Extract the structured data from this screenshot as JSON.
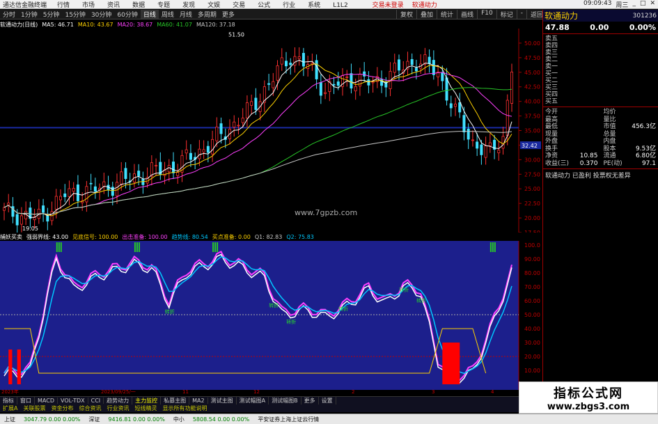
{
  "titlebar": {
    "app_title": "通达信金融终端",
    "menu": [
      "行情",
      "市场",
      "资讯",
      "数据",
      "专题",
      "发现",
      "文娱",
      "交易",
      "公式",
      "行业",
      "系统",
      "L1L2"
    ],
    "alerts": [
      "交易未登录",
      "软通动力"
    ],
    "time": "09:09:43",
    "weekday": "周三"
  },
  "toolbar": {
    "periods": [
      "分时",
      "1分钟",
      "5分钟",
      "15分钟",
      "30分钟",
      "60分钟",
      "日线",
      "周线",
      "月线",
      "多周期",
      "更多"
    ],
    "active": "日线",
    "right": [
      "复权",
      "叠加",
      "统计",
      "画线",
      "F10",
      "标记",
      "-",
      "返回"
    ]
  },
  "main": {
    "stock": "软通动力(日线)",
    "ma": [
      {
        "name": "MA5",
        "value": "46.71",
        "color": "#ffffff"
      },
      {
        "name": "MA10",
        "value": "43.67",
        "color": "#ffd200"
      },
      {
        "name": "MA20",
        "value": "38.67",
        "color": "#ff40ff"
      },
      {
        "name": "MA60",
        "value": "41.07",
        "color": "#28c828"
      },
      {
        "name": "MA120",
        "value": "37.18",
        "color": "#c8c8c8"
      }
    ],
    "high_label": "51.50",
    "low_label": "19.05",
    "price_tag": "32.42",
    "axis": [
      "50.00",
      "47.50",
      "45.00",
      "42.50",
      "40.00",
      "37.50",
      "35.00",
      "32.50",
      "30.00",
      "27.50",
      "25.00",
      "22.50",
      "20.00",
      "17.50"
    ],
    "site": "www.7gpzb.com"
  },
  "sub": {
    "title": "捕妖买卖",
    "params": [
      {
        "label": "强弱界线",
        "value": "43.00",
        "color": "#ffffff"
      },
      {
        "label": "见底信号",
        "value": "100.00",
        "color": "#ffd200"
      },
      {
        "label": "出击准备",
        "value": "100.00",
        "color": "#ff40ff"
      },
      {
        "label": "趋势线",
        "value": "80.54",
        "color": "#00c8ff"
      },
      {
        "label": "买点准备",
        "value": "0.00",
        "color": "#ffd200"
      },
      {
        "label": "Q1",
        "value": "82.83",
        "color": "#c8c8c8"
      },
      {
        "label": "Q2",
        "value": "75.83",
        "color": "#00c8ff"
      }
    ],
    "axis": [
      "100.0",
      "90.00",
      "80.00",
      "70.00",
      "60.00",
      "50.00",
      "40.00",
      "30.00",
      "20.00",
      "10.00"
    ],
    "markers": [
      "转折",
      "转折",
      "转折",
      "转折",
      "转折",
      "转折"
    ]
  },
  "dates": [
    "2023年",
    "2023/09/25/一",
    "11",
    "12",
    "2",
    "3",
    "4",
    "5"
  ],
  "tabs": [
    "指标",
    "窗口",
    "MACD",
    "VOL-TDX",
    "CCI",
    "趋势动力",
    "主力监控",
    "私募主图",
    "MA2",
    "测试主图",
    "测试幅图A",
    "测试幅图B",
    "更多",
    "设置"
  ],
  "tabs_active": "主力监控",
  "tabs2": [
    "扩展A",
    "关联股票",
    "资金分布",
    "综合资讯",
    "行业资讯",
    "短线精灵",
    "显示所有功能说明"
  ],
  "status": [
    {
      "label": "上证",
      "value": "3047.79",
      "chg": "0.00",
      "pct": "0.00%",
      "cls": "dn"
    },
    {
      "label": "深证",
      "value": "9416.81",
      "chg": "0.00",
      "pct": "0.00%",
      "cls": "dn"
    },
    {
      "label": "中小",
      "value": "5808.54",
      "chg": "0.00",
      "pct": "0.00%",
      "cls": "dn"
    },
    {
      "label": "平安证券上海上证云行情",
      "value": "",
      "chg": "",
      "pct": "",
      "cls": "up"
    }
  ],
  "side": {
    "name": "软通动力",
    "code": "301236",
    "price": "47.88",
    "chg": "0.00",
    "pct": "0.00%",
    "sell": [
      "卖五",
      "卖四",
      "卖三",
      "卖二",
      "卖一"
    ],
    "buy": [
      "买一",
      "买二",
      "买三",
      "买四",
      "买五"
    ],
    "grid": [
      [
        "今开",
        "",
        "均价",
        ""
      ],
      [
        "最高",
        "",
        "量比",
        ""
      ],
      [
        "最低",
        "",
        "市值",
        "456.3亿"
      ],
      [
        "现量",
        "",
        "总量",
        ""
      ],
      [
        "外盘",
        "",
        "内盘",
        ""
      ],
      [
        "换手",
        "",
        "股本",
        "9.53亿"
      ],
      [
        "净资",
        "10.85",
        "流通",
        "6.80亿"
      ],
      [
        "收益(三)",
        "0.370",
        "PE(动)",
        "97.1"
      ]
    ],
    "note": "软通动力 已盈利 投票权无差异"
  },
  "watermark": {
    "title": "指标公式网",
    "url": "www.zbgs3.com"
  },
  "chart_data": {
    "type": "line",
    "title": "软通动力(日线)",
    "series": [
      {
        "name": "MA5",
        "values": []
      },
      {
        "name": "MA120",
        "values": []
      }
    ],
    "ylim": [
      17.5,
      52.5
    ]
  }
}
